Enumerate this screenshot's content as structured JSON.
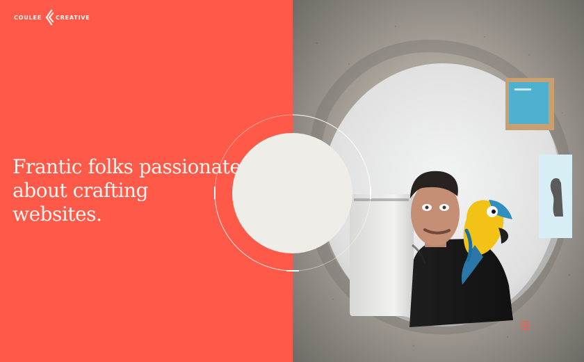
{
  "brand": {
    "left": "COULEE",
    "right": "CREATIVE",
    "mark_icon": "double-chevron-left-icon",
    "accent": "#ff5a49"
  },
  "hero": {
    "headline": "Frantic folks passionate about crafting websites."
  },
  "menu": {
    "icon": "grid-dots-icon"
  },
  "photo": {
    "subject": "man-with-parrot-icon"
  },
  "colors": {
    "background": "#ff5a49",
    "disc": "#eeede8",
    "text": "#fff4ef"
  }
}
